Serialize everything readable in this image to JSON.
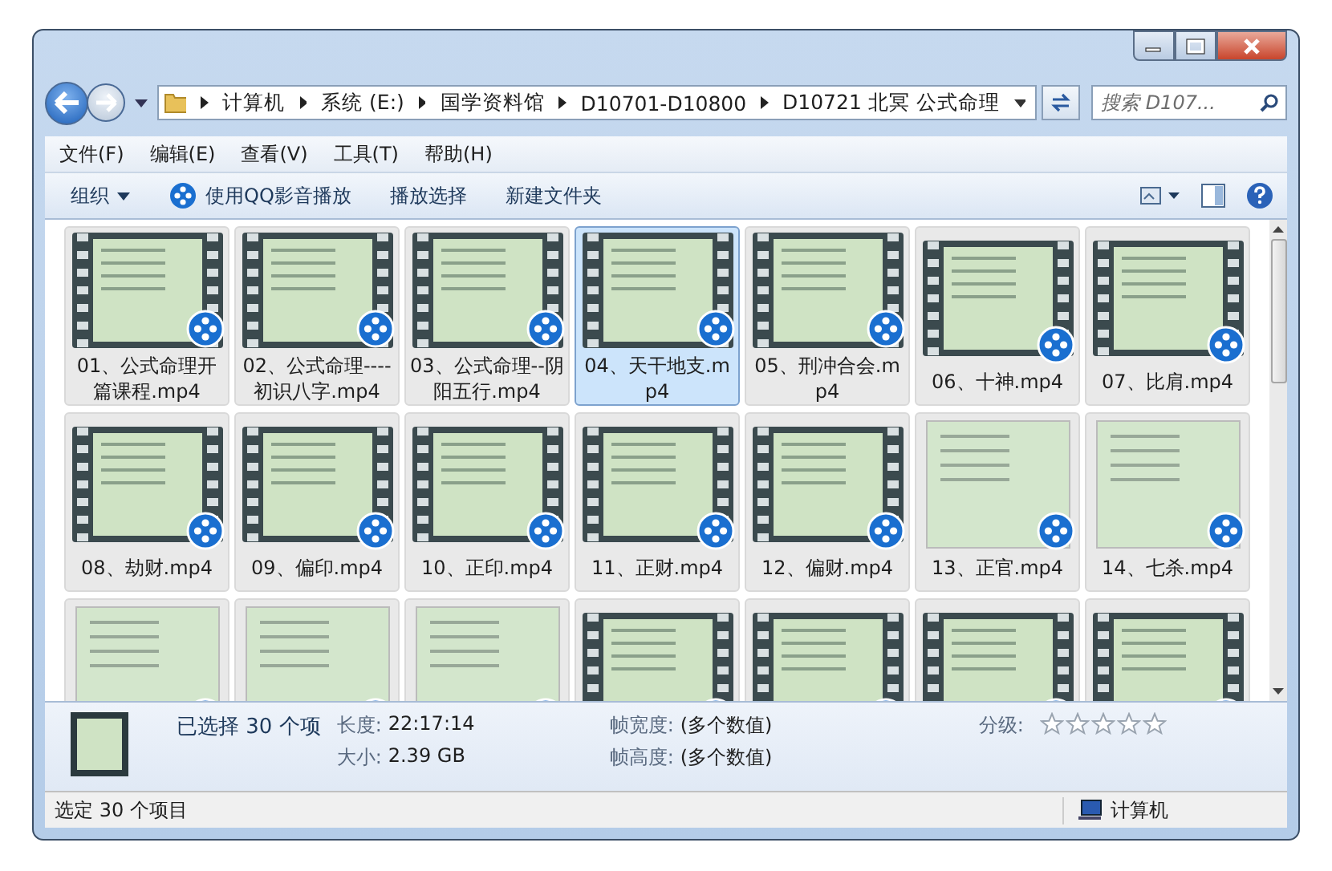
{
  "address": {
    "crumbs": [
      "计算机",
      "系统 (E:)",
      "国学资料馆",
      "D10701-D10800",
      "D10721 北冥 公式命理"
    ]
  },
  "search": {
    "placeholder": "搜索 D107..."
  },
  "menu": [
    "文件(F)",
    "编辑(E)",
    "查看(V)",
    "工具(T)",
    "帮助(H)"
  ],
  "toolbar": [
    {
      "label": "组织",
      "kind": "dropdown"
    },
    {
      "label": "使用QQ影音播放",
      "kind": "player"
    },
    {
      "label": "播放选择",
      "kind": "plain"
    },
    {
      "label": "新建文件夹",
      "kind": "plain"
    }
  ],
  "files": [
    {
      "label": "01、公式命理开篇课程.mp4",
      "selected": true,
      "hover": false,
      "kind": "video"
    },
    {
      "label": "02、公式命理----初识八字.mp4",
      "selected": true,
      "hover": false,
      "kind": "video"
    },
    {
      "label": "03、公式命理--阴阳五行.mp4",
      "selected": true,
      "hover": false,
      "kind": "video"
    },
    {
      "label": "04、天干地支.mp4",
      "selected": true,
      "hover": true,
      "kind": "video"
    },
    {
      "label": "05、刑冲合会.mp4",
      "selected": true,
      "hover": false,
      "kind": "video"
    },
    {
      "label": "06、十神.mp4",
      "selected": true,
      "hover": false,
      "kind": "video"
    },
    {
      "label": "07、比肩.mp4",
      "selected": true,
      "hover": false,
      "kind": "video"
    },
    {
      "label": "08、劫财.mp4",
      "selected": true,
      "hover": false,
      "kind": "video"
    },
    {
      "label": "09、偏印.mp4",
      "selected": true,
      "hover": false,
      "kind": "video"
    },
    {
      "label": "10、正印.mp4",
      "selected": true,
      "hover": false,
      "kind": "video"
    },
    {
      "label": "11、正财.mp4",
      "selected": true,
      "hover": false,
      "kind": "video"
    },
    {
      "label": "12、偏财.mp4",
      "selected": true,
      "hover": false,
      "kind": "video"
    },
    {
      "label": "13、正官.mp4",
      "selected": true,
      "hover": false,
      "kind": "doc"
    },
    {
      "label": "14、七杀.mp4",
      "selected": true,
      "hover": false,
      "kind": "doc"
    },
    {
      "selected": true,
      "hover": false,
      "kind": "doc"
    },
    {
      "selected": true,
      "hover": false,
      "kind": "doc"
    },
    {
      "selected": true,
      "hover": false,
      "kind": "doc"
    },
    {
      "selected": true,
      "hover": false,
      "kind": "video"
    },
    {
      "selected": true,
      "hover": false,
      "kind": "video"
    },
    {
      "selected": true,
      "hover": false,
      "kind": "video"
    },
    {
      "selected": true,
      "hover": false,
      "kind": "video"
    }
  ],
  "details": {
    "title": "已选择 30 个项",
    "fields": [
      {
        "label": "长度:",
        "value": "22:17:14"
      },
      {
        "label": "大小:",
        "value": "2.39 GB"
      },
      {
        "label": "帧宽度:",
        "value": "(多个数值)"
      },
      {
        "label": "帧高度:",
        "value": "(多个数值)"
      }
    ],
    "rating_label": "分级:",
    "stars": 0
  },
  "status_bar": {
    "text": "选定 30 个项目",
    "location": "计算机"
  }
}
